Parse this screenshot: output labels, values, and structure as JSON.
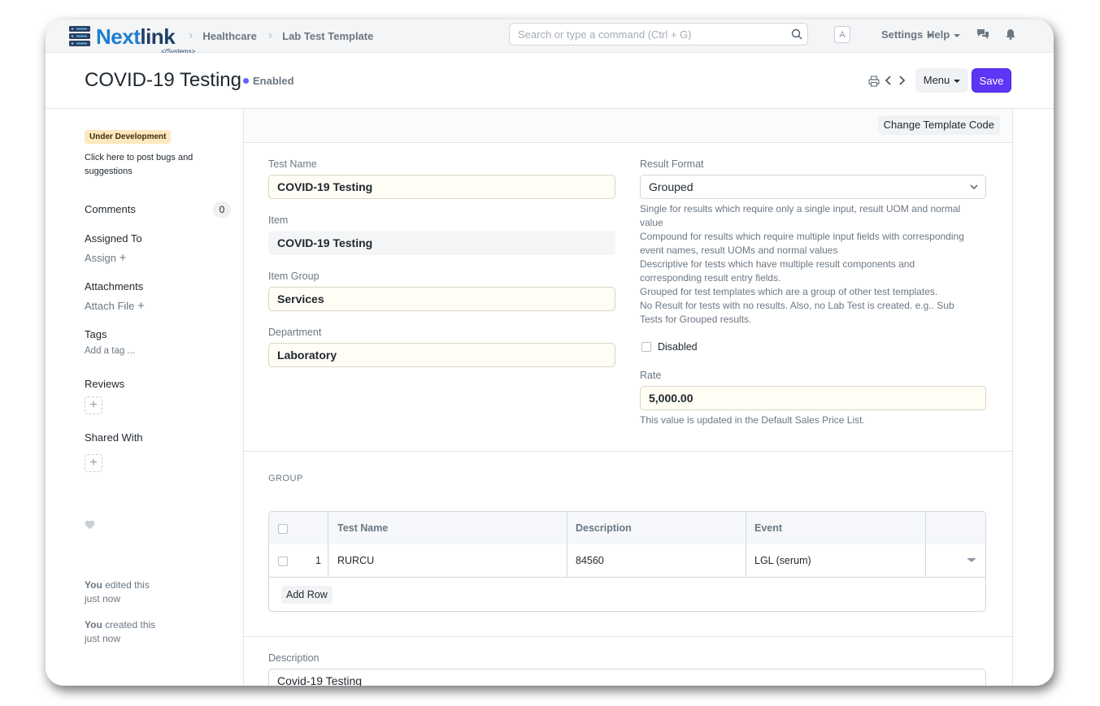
{
  "navbar": {
    "logo_main_a": "Next",
    "logo_main_b": "link",
    "logo_sub": "</Systems>",
    "breadcrumbs": [
      "Healthcare",
      "Lab Test Template"
    ],
    "search_placeholder": "Search or type a command (Ctrl + G)",
    "avatar_letter": "A",
    "settings_label": "Settings",
    "help_label": "Help"
  },
  "page": {
    "title": "COVID-19 Testing",
    "status": "Enabled",
    "menu_label": "Menu",
    "save_label": "Save",
    "accent_color": "#5e35f5"
  },
  "sidebar": {
    "dev_badge": "Under Development",
    "dev_note": "Click here to post bugs and suggestions",
    "comments_label": "Comments",
    "comments_count": "0",
    "assigned_label": "Assigned To",
    "assign_link": "Assign",
    "attachments_label": "Attachments",
    "attach_link": "Attach File",
    "tags_label": "Tags",
    "tag_link": "Add a tag ...",
    "reviews_label": "Reviews",
    "shared_label": "Shared With",
    "activity": [
      {
        "who": "You",
        "what": "edited this",
        "when": "just now"
      },
      {
        "who": "You",
        "what": "created this",
        "when": "just now"
      }
    ]
  },
  "form": {
    "change_template_code": "Change Template Code",
    "test_name_label": "Test Name",
    "test_name_value": "COVID-19 Testing",
    "item_label": "Item",
    "item_value": "COVID-19 Testing",
    "item_group_label": "Item Group",
    "item_group_value": "Services",
    "department_label": "Department",
    "department_value": "Laboratory",
    "result_format_label": "Result Format",
    "result_format_value": "Grouped",
    "result_format_help": [
      "Single for results which require only a single input, result UOM and normal",
      "value",
      "Compound for results which require multiple input fields with corresponding",
      "event names, result UOMs and normal values",
      "Descriptive for tests which have multiple result components and",
      "corresponding result entry fields.",
      "Grouped for test templates which are a group of other test templates.",
      "No Result for tests with no results. Also, no Lab Test is created. e.g.. Sub",
      "Tests for Grouped results."
    ],
    "disabled_label": "Disabled",
    "rate_label": "Rate",
    "rate_value": "5,000.00",
    "rate_help": "This value is updated in the Default Sales Price List.",
    "group_section": "GROUP",
    "grid_headers": [
      "Test Name",
      "Description",
      "Event"
    ],
    "grid_rows": [
      {
        "idx": "1",
        "test_name": "RURCU",
        "description": "84560",
        "event": "LGL (serum)"
      }
    ],
    "add_row_label": "Add Row",
    "description_label": "Description",
    "description_value": "Covid-19 Testing"
  }
}
